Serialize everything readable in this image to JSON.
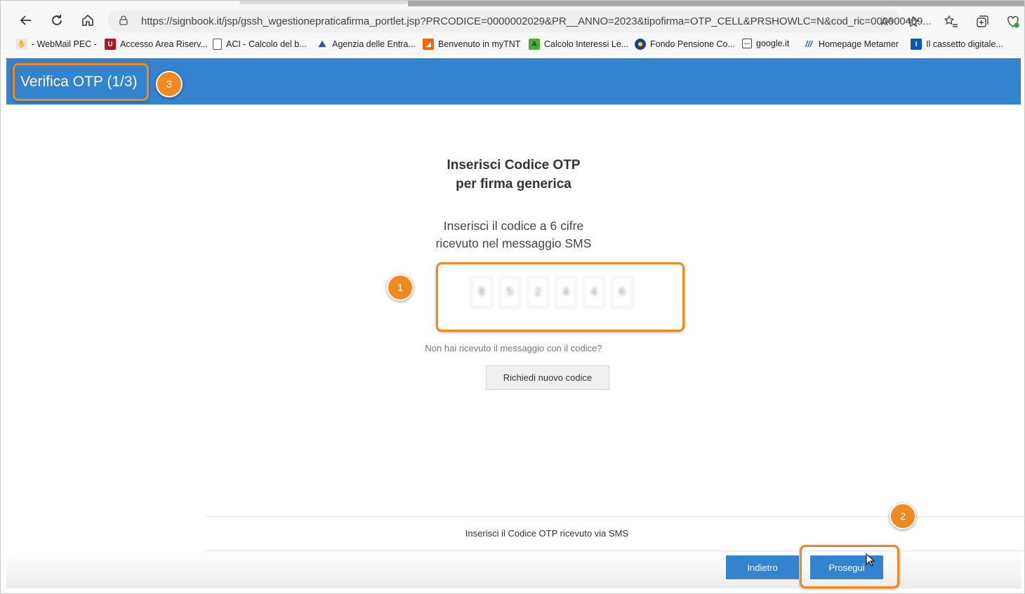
{
  "browser": {
    "url": "https://signbook.it/jsp/gssh_wgestionepraticafirma_portlet.jsp?PRCODICE=0000002029&PR__ANNO=2023&tipofirma=OTP_CELL&PRSHOWLC=N&cod_ric=000000469...",
    "read_aloud_label": "Aᴬ"
  },
  "bookmarks": [
    {
      "label": "- WebMail PEC -",
      "icon": "hand-icon",
      "color": "#dddddd"
    },
    {
      "label": "Accesso Area Riserv...",
      "icon": "u-logo-icon",
      "color": "#b3152b"
    },
    {
      "label": "ACI - Calcolo del b...",
      "icon": "page-icon",
      "color": "#ffffff"
    },
    {
      "label": "Agenzia delle Entra...",
      "icon": "agenzia-icon",
      "color": "#2b5aa8"
    },
    {
      "label": "Benvenuto in myTNT",
      "icon": "tnt-icon",
      "color": "#ff6200"
    },
    {
      "label": "Calcolo Interessi Le...",
      "icon": "a-logo-icon",
      "color": "#4caf2e"
    },
    {
      "label": "Fondo Pensione Co...",
      "icon": "fondo-icon",
      "color": "#1c3d8a"
    },
    {
      "label": "google.it",
      "icon": "google-icon",
      "color": "#ffffff"
    },
    {
      "label": "Homepage Metamer",
      "icon": "metamer-icon",
      "color": "#1e4fb3"
    },
    {
      "label": "Il cassetto digitale...",
      "icon": "cassetto-icon",
      "color": "#0a57b8"
    }
  ],
  "header": {
    "title": "Verifica OTP (1/3)"
  },
  "steps": {
    "one": "1",
    "two": "2",
    "three": "3"
  },
  "main": {
    "title_line1": "Inserisci Codice OTP",
    "title_line2": "per firma generica",
    "instruction_line1": "Inserisci il codice a 6 cifre",
    "instruction_line2": "ricevuto nel messaggio SMS",
    "otp_digits": [
      "8",
      "5",
      "2",
      "4",
      "4",
      "6"
    ],
    "no_code_text": "Non hai ricevuto il messaggio con il codice?",
    "request_new_code": "Richiedi nuovo codice"
  },
  "footer": {
    "message": "Inserisci il Codice OTP ricevuto via SMS",
    "back_label": "Indietro",
    "continue_label": "Prosegui"
  },
  "colors": {
    "header_bg": "#3483cf",
    "highlight": "#f08a1c",
    "button_blue": "#3483cf"
  }
}
